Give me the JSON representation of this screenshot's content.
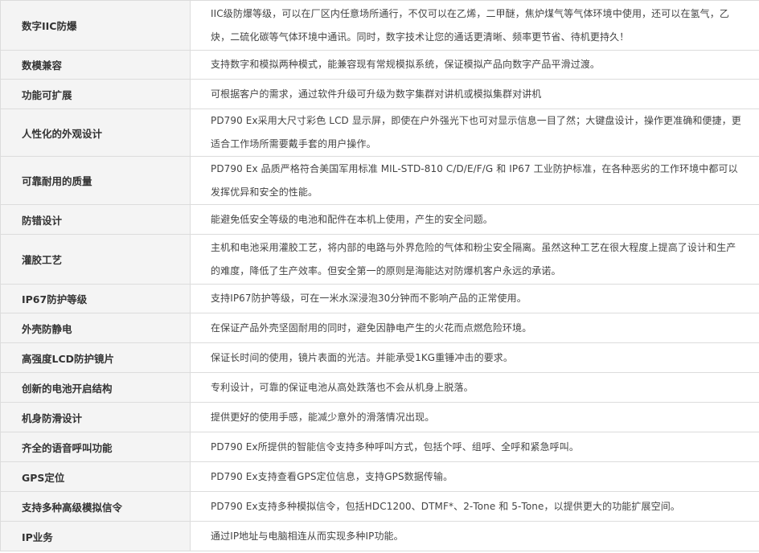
{
  "rows": [
    {
      "feature": "数字IIC防爆",
      "desc": "IIC级防爆等级，可以在厂区内任意场所通行，不仅可以在乙烯，二甲醚，焦炉煤气等气体环境中使用，还可以在氢气，乙炔，二硫化碳等气体环境中通讯。同时，数字技术让您的通话更清晰、频率更节省、待机更持久！"
    },
    {
      "feature": "数模兼容",
      "desc": "支持数字和模拟两种模式，能兼容现有常规模拟系统，保证模拟产品向数字产品平滑过渡。"
    },
    {
      "feature": "功能可扩展",
      "desc": "可根据客户的需求，通过软件升级可升级为数字集群对讲机或模拟集群对讲机"
    },
    {
      "feature": "人性化的外观设计",
      "desc": "PD790 Ex采用大尺寸彩色 LCD 显示屏，即使在户外强光下也可对显示信息一目了然；大键盘设计，操作更准确和便捷，更适合工作场所需要戴手套的用户操作。"
    },
    {
      "feature": "可靠耐用的质量",
      "desc": "PD790 Ex 品质严格符合美国军用标准 MIL-STD-810 C/D/E/F/G 和 IP67 工业防护标准，在各种恶劣的工作环境中都可以发挥优异和安全的性能。"
    },
    {
      "feature": "防错设计",
      "desc": "能避免低安全等级的电池和配件在本机上使用，产生的安全问题。"
    },
    {
      "feature": "灌胶工艺",
      "desc": "主机和电池采用灌胶工艺，将内部的电路与外界危险的气体和粉尘安全隔离。虽然这种工艺在很大程度上提高了设计和生产的难度，降低了生产效率。但安全第一的原则是海能达对防爆机客户永远的承诺。"
    },
    {
      "feature": "IP67防护等级",
      "desc": "支持IP67防护等级，可在一米水深浸泡30分钟而不影响产品的正常使用。"
    },
    {
      "feature": "外壳防静电",
      "desc": "在保证产品外壳坚固耐用的同时，避免因静电产生的火花而点燃危险环境。"
    },
    {
      "feature": "高强度LCD防护镜片",
      "desc": "保证长时间的使用，镜片表面的光洁。并能承受1KG重锤冲击的要求。"
    },
    {
      "feature": "创新的电池开启结构",
      "desc": "专利设计，可靠的保证电池从高处跌落也不会从机身上脱落。"
    },
    {
      "feature": "机身防滑设计",
      "desc": "提供更好的使用手感，能减少意外的滑落情况出现。"
    },
    {
      "feature": "齐全的语音呼叫功能",
      "desc": "PD790 Ex所提供的智能信令支持多种呼叫方式，包括个呼、组呼、全呼和紧急呼叫。"
    },
    {
      "feature": "GPS定位",
      "desc": "PD790 Ex支持查看GPS定位信息，支持GPS数据传输。"
    },
    {
      "feature": "支持多种高级模拟信令",
      "desc": "PD790 Ex支持多种模拟信令，包括HDC1200、DTMF*、2-Tone 和 5-Tone，以提供更大的功能扩展空间。"
    },
    {
      "feature": "IP业务",
      "desc": "通过IP地址与电脑相连从而实现多种IP功能。"
    }
  ]
}
